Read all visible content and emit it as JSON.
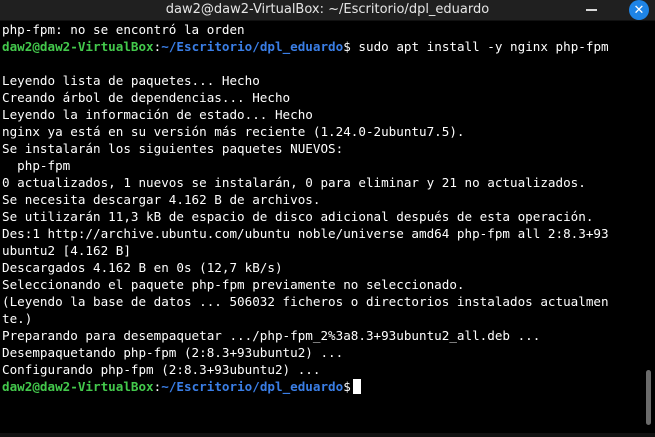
{
  "window": {
    "title": "daw2@daw2-VirtualBox: ~/Escritorio/dpl_eduardo",
    "close_glyph": "✕"
  },
  "prompt": {
    "user_host": "daw2@daw2-VirtualBox",
    "sep": ":",
    "path": "~/Escritorio/dpl_eduardo",
    "symbol": "$"
  },
  "command": " sudo apt install -y nginx php-fpm",
  "lines": [
    "php-fpm: no se encontró la orden",
    "",
    "",
    "Leyendo lista de paquetes... Hecho",
    "Creando árbol de dependencias... Hecho",
    "Leyendo la información de estado... Hecho",
    "nginx ya está en su versión más reciente (1.24.0-2ubuntu7.5).",
    "Se instalarán los siguientes paquetes NUEVOS:",
    "  php-fpm",
    "0 actualizados, 1 nuevos se instalarán, 0 para eliminar y 21 no actualizados.",
    "Se necesita descargar 4.162 B de archivos.",
    "Se utilizarán 11,3 kB de espacio de disco adicional después de esta operación.",
    "Des:1 http://archive.ubuntu.com/ubuntu noble/universe amd64 php-fpm all 2:8.3+93",
    "ubuntu2 [4.162 B]",
    "Descargados 4.162 B en 0s (12,7 kB/s)",
    "Seleccionando el paquete php-fpm previamente no seleccionado.",
    "(Leyendo la base de datos ... 506032 ficheros o directorios instalados actualmen",
    "te.)",
    "Preparando para desempaquetar .../php-fpm_2%3a8.3+93ubuntu2_all.deb ...",
    "Desempaquetando php-fpm (2:8.3+93ubuntu2) ...",
    "Configurando php-fpm (2:8.3+93ubuntu2) ..."
  ],
  "colors": {
    "prompt_user": "#43c94c",
    "prompt_path": "#3a7ee6",
    "close_button": "#1e84e6"
  }
}
